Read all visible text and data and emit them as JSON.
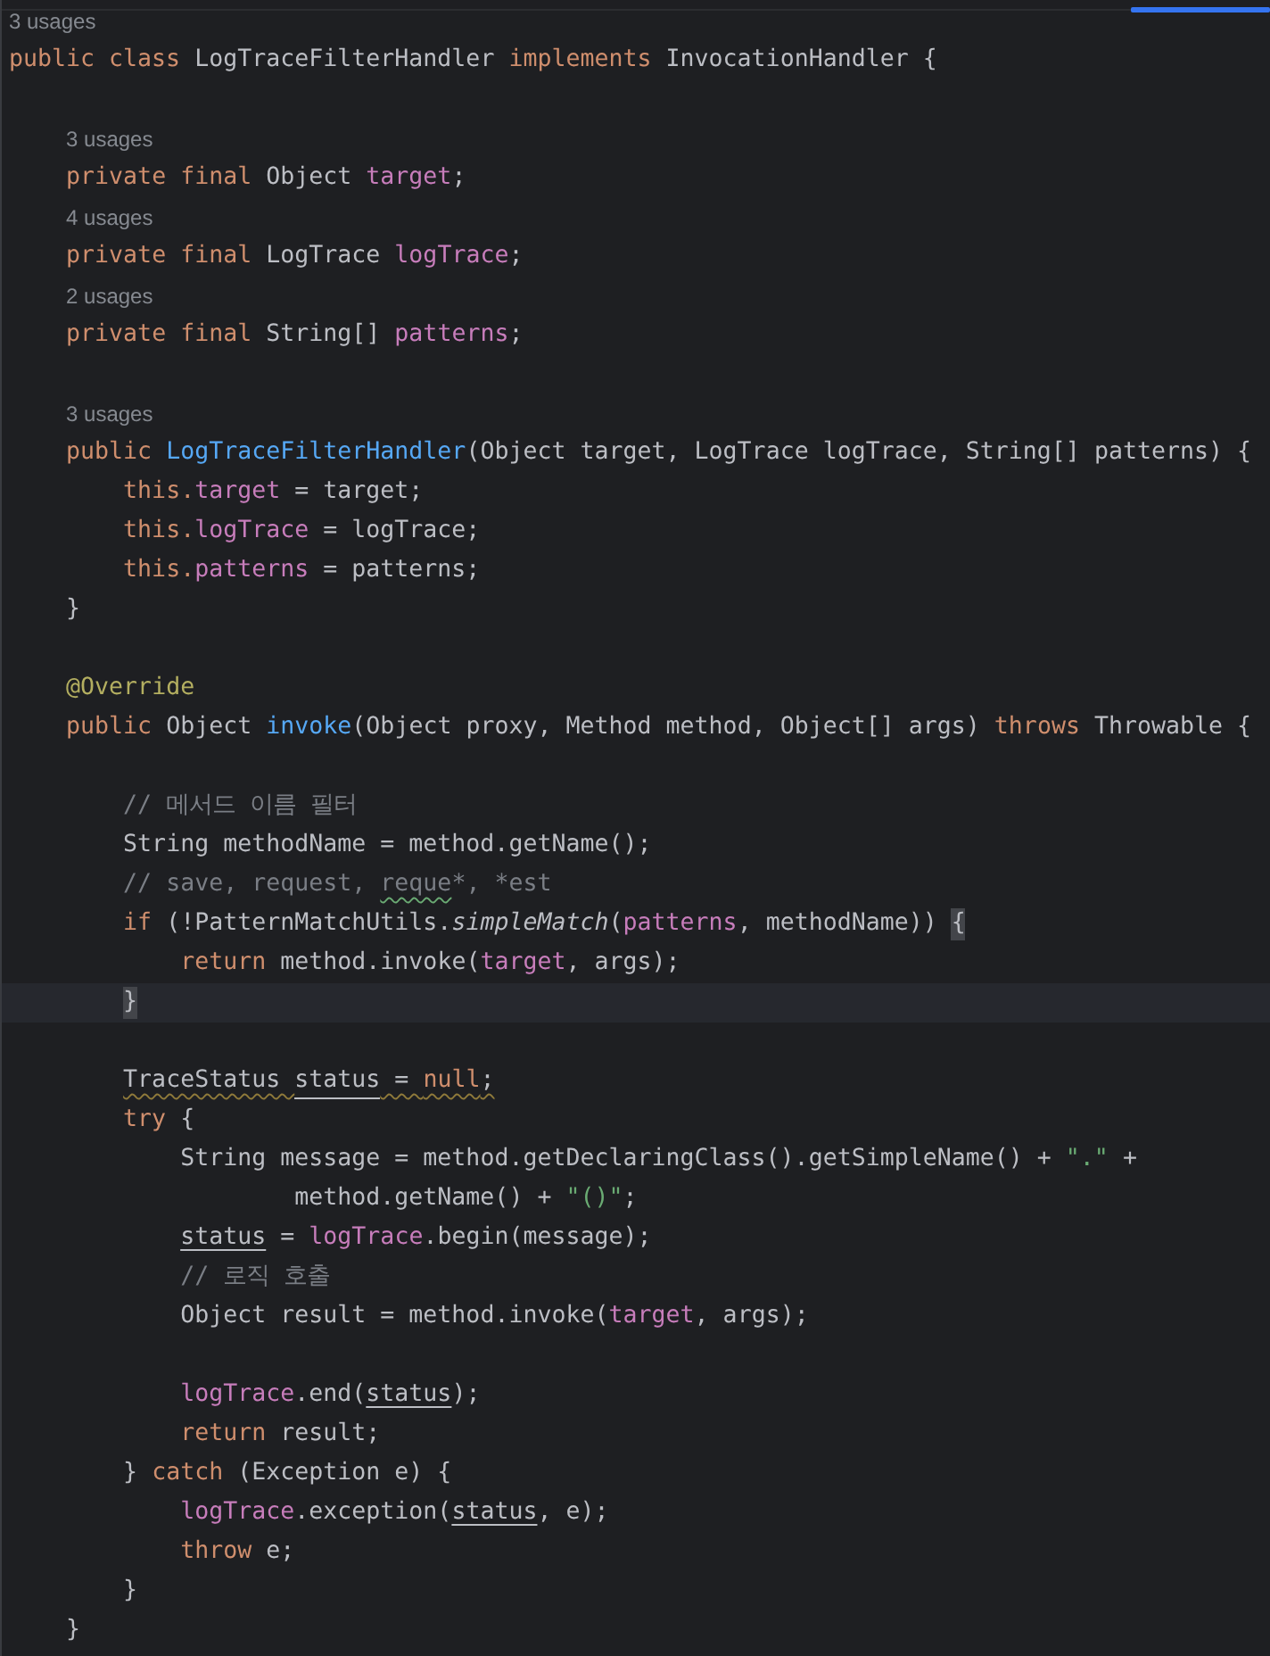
{
  "editor": {
    "lines": [
      {
        "kind": "usages",
        "text": "3 usages"
      },
      {
        "kind": "code",
        "tokens": [
          {
            "kind": "kw",
            "text": "public class"
          },
          {
            "kind": "plain",
            "text": " LogTraceFilterHandler "
          },
          {
            "kind": "kw",
            "text": "implements"
          },
          {
            "kind": "plain",
            "text": " InvocationHandler {"
          }
        ]
      },
      {
        "kind": "blank"
      },
      {
        "kind": "usages",
        "text": "3 usages"
      },
      {
        "kind": "code",
        "tokens": [
          {
            "kind": "kw",
            "text": "    private final"
          },
          {
            "kind": "plain",
            "text": " Object "
          },
          {
            "kind": "field",
            "text": "target"
          },
          {
            "kind": "plain",
            "text": ";"
          }
        ]
      },
      {
        "kind": "usages",
        "text": "4 usages"
      },
      {
        "kind": "code",
        "tokens": [
          {
            "kind": "kw",
            "text": "    private final"
          },
          {
            "kind": "plain",
            "text": " LogTrace "
          },
          {
            "kind": "field",
            "text": "logTrace"
          },
          {
            "kind": "plain",
            "text": ";"
          }
        ]
      },
      {
        "kind": "usages",
        "text": "2 usages"
      },
      {
        "kind": "code",
        "tokens": [
          {
            "kind": "kw",
            "text": "    private final"
          },
          {
            "kind": "plain",
            "text": " String[] "
          },
          {
            "kind": "field",
            "text": "patterns"
          },
          {
            "kind": "plain",
            "text": ";"
          }
        ]
      },
      {
        "kind": "blank"
      },
      {
        "kind": "usages",
        "text": "3 usages"
      },
      {
        "kind": "code",
        "tokens": [
          {
            "kind": "kw",
            "text": "    public "
          },
          {
            "kind": "method",
            "text": "LogTraceFilterHandler"
          },
          {
            "kind": "plain",
            "text": "(Object target, LogTrace logTrace, String[] patterns) {"
          }
        ]
      },
      {
        "kind": "code",
        "tokens": [
          {
            "kind": "kw",
            "text": "        this."
          },
          {
            "kind": "field",
            "text": "target"
          },
          {
            "kind": "plain",
            "text": " = target;"
          }
        ]
      },
      {
        "kind": "code",
        "tokens": [
          {
            "kind": "kw",
            "text": "        this."
          },
          {
            "kind": "field",
            "text": "logTrace"
          },
          {
            "kind": "plain",
            "text": " = logTrace;"
          }
        ]
      },
      {
        "kind": "code",
        "tokens": [
          {
            "kind": "kw",
            "text": "        this."
          },
          {
            "kind": "field",
            "text": "patterns"
          },
          {
            "kind": "plain",
            "text": " = patterns;"
          }
        ]
      },
      {
        "kind": "code",
        "tokens": [
          {
            "kind": "plain",
            "text": "    }"
          }
        ]
      },
      {
        "kind": "blank"
      },
      {
        "kind": "code",
        "tokens": [
          {
            "kind": "annotation",
            "text": "    @Override"
          }
        ]
      },
      {
        "kind": "code",
        "tokens": [
          {
            "kind": "kw",
            "text": "    public"
          },
          {
            "kind": "plain",
            "text": " Object "
          },
          {
            "kind": "method",
            "text": "invoke"
          },
          {
            "kind": "plain",
            "text": "(Object proxy, Method method, Object[] args) "
          },
          {
            "kind": "kw",
            "text": "throws"
          },
          {
            "kind": "plain",
            "text": " Throwable {"
          }
        ]
      },
      {
        "kind": "blank"
      },
      {
        "kind": "code",
        "tokens": [
          {
            "kind": "comment",
            "text": "        // 메서드 이름 필터"
          }
        ]
      },
      {
        "kind": "code",
        "tokens": [
          {
            "kind": "plain",
            "text": "        String methodName = method.getName();"
          }
        ]
      },
      {
        "kind": "code",
        "tokens": [
          {
            "kind": "comment",
            "text": "        // save, request, "
          },
          {
            "kind": "comment",
            "text": "reque",
            "typo": true
          },
          {
            "kind": "comment",
            "text": "*, *est"
          }
        ]
      },
      {
        "kind": "code",
        "tokens": [
          {
            "kind": "kw",
            "text": "        if"
          },
          {
            "kind": "plain",
            "text": " (!PatternMatchUtils."
          },
          {
            "kind": "static",
            "text": "simpleMatch"
          },
          {
            "kind": "plain",
            "text": "("
          },
          {
            "kind": "field",
            "text": "patterns"
          },
          {
            "kind": "plain",
            "text": ", methodName)) "
          },
          {
            "kind": "plain",
            "text": "{",
            "matched": true
          }
        ]
      },
      {
        "kind": "code",
        "tokens": [
          {
            "kind": "kw",
            "text": "            return"
          },
          {
            "kind": "plain",
            "text": " method.invoke("
          },
          {
            "kind": "field",
            "text": "target"
          },
          {
            "kind": "plain",
            "text": ", args);"
          }
        ]
      },
      {
        "kind": "code",
        "current": true,
        "tokens": [
          {
            "kind": "plain",
            "text": "        }",
            "matched": true
          }
        ]
      },
      {
        "kind": "blank"
      },
      {
        "kind": "code",
        "tokens": [
          {
            "kind": "plain",
            "text": "        TraceStatus ",
            "warning": true
          },
          {
            "kind": "plain",
            "text": "status",
            "underlined": true,
            "warning": true
          },
          {
            "kind": "plain",
            "text": " = ",
            "warning": true
          },
          {
            "kind": "kw",
            "text": "null",
            "warning": true
          },
          {
            "kind": "plain",
            "text": ";",
            "warning": true
          }
        ]
      },
      {
        "kind": "code",
        "tokens": [
          {
            "kind": "kw",
            "text": "        try"
          },
          {
            "kind": "plain",
            "text": " {"
          }
        ]
      },
      {
        "kind": "code",
        "tokens": [
          {
            "kind": "plain",
            "text": "            String message = method.getDeclaringClass().getSimpleName() + "
          },
          {
            "kind": "string",
            "text": "\".\""
          },
          {
            "kind": "plain",
            "text": " +"
          }
        ]
      },
      {
        "kind": "code",
        "tokens": [
          {
            "kind": "plain",
            "text": "                    method.getName() + "
          },
          {
            "kind": "string",
            "text": "\"()\""
          },
          {
            "kind": "plain",
            "text": ";"
          }
        ]
      },
      {
        "kind": "code",
        "tokens": [
          {
            "kind": "plain",
            "text": "            status",
            "underlined": true
          },
          {
            "kind": "plain",
            "text": " = "
          },
          {
            "kind": "field",
            "text": "logTrace"
          },
          {
            "kind": "plain",
            "text": ".begin(message);"
          }
        ]
      },
      {
        "kind": "code",
        "tokens": [
          {
            "kind": "comment",
            "text": "            // 로직 호출"
          }
        ]
      },
      {
        "kind": "code",
        "tokens": [
          {
            "kind": "plain",
            "text": "            Object result = method.invoke("
          },
          {
            "kind": "field",
            "text": "target"
          },
          {
            "kind": "plain",
            "text": ", args);"
          }
        ]
      },
      {
        "kind": "blank"
      },
      {
        "kind": "code",
        "tokens": [
          {
            "kind": "field",
            "text": "            logTrace"
          },
          {
            "kind": "plain",
            "text": ".end("
          },
          {
            "kind": "plain",
            "text": "status",
            "underlined": true
          },
          {
            "kind": "plain",
            "text": ");"
          }
        ]
      },
      {
        "kind": "code",
        "tokens": [
          {
            "kind": "kw",
            "text": "            return"
          },
          {
            "kind": "plain",
            "text": " result;"
          }
        ]
      },
      {
        "kind": "code",
        "tokens": [
          {
            "kind": "plain",
            "text": "        } "
          },
          {
            "kind": "kw",
            "text": "catch"
          },
          {
            "kind": "plain",
            "text": " (Exception e) {"
          }
        ]
      },
      {
        "kind": "code",
        "tokens": [
          {
            "kind": "field",
            "text": "            logTrace"
          },
          {
            "kind": "plain",
            "text": ".exception("
          },
          {
            "kind": "plain",
            "text": "status",
            "underlined": true
          },
          {
            "kind": "plain",
            "text": ", e);"
          }
        ]
      },
      {
        "kind": "code",
        "tokens": [
          {
            "kind": "kw",
            "text": "            throw"
          },
          {
            "kind": "plain",
            "text": " e;"
          }
        ]
      },
      {
        "kind": "code",
        "tokens": [
          {
            "kind": "plain",
            "text": "        }"
          }
        ]
      },
      {
        "kind": "code",
        "tokens": [
          {
            "kind": "plain",
            "text": "    }"
          }
        ]
      }
    ]
  }
}
